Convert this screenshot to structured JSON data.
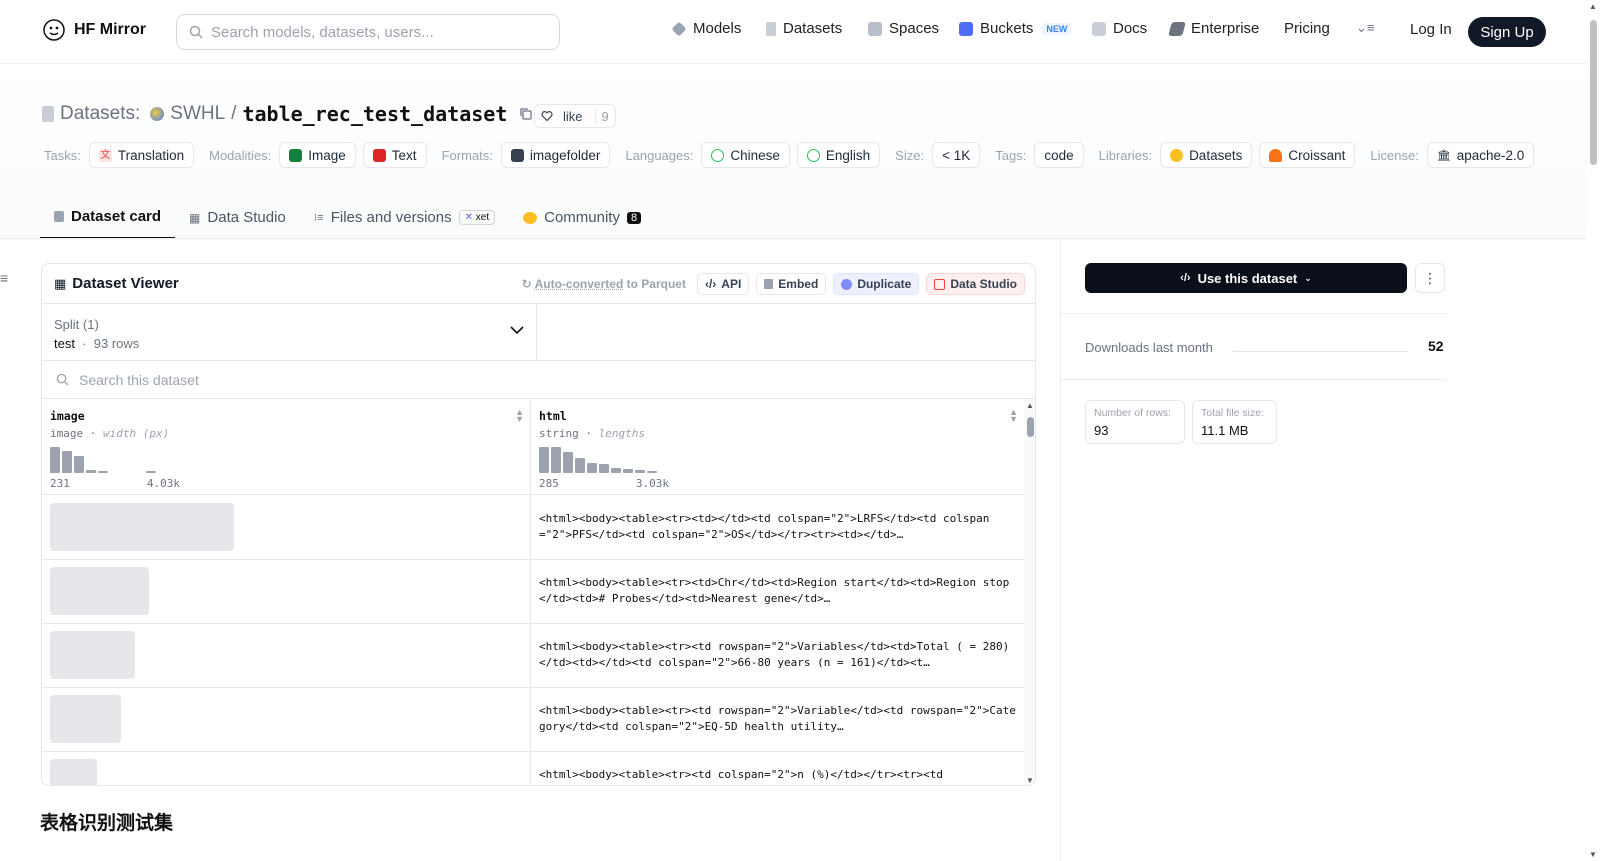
{
  "brand": {
    "name": "HF Mirror"
  },
  "search": {
    "placeholder": "Search models, datasets, users..."
  },
  "nav": {
    "models": "Models",
    "datasets": "Datasets",
    "spaces": "Spaces",
    "buckets": "Buckets",
    "new_badge": "NEW",
    "docs": "Docs",
    "enterprise": "Enterprise",
    "pricing": "Pricing",
    "login": "Log In",
    "signup": "Sign Up"
  },
  "repo": {
    "type_label": "Datasets:",
    "owner": "SWHL",
    "name": "table_rec_test_dataset",
    "like_label": "like",
    "like_count": "9"
  },
  "tags": {
    "tasks_label": "Tasks:",
    "task": "Translation",
    "modalities_label": "Modalities:",
    "modality_image": "Image",
    "modality_text": "Text",
    "formats_label": "Formats:",
    "format": "imagefolder",
    "languages_label": "Languages:",
    "lang_zh": "Chinese",
    "lang_en": "English",
    "size_label": "Size:",
    "size": "< 1K",
    "tags_label": "Tags:",
    "tag": "code",
    "libraries_label": "Libraries:",
    "lib_datasets": "Datasets",
    "lib_croissant": "Croissant",
    "license_label": "License:",
    "license": "apache-2.0"
  },
  "tabs": {
    "card": "Dataset card",
    "studio": "Data Studio",
    "files": "Files and versions",
    "xet": "xet",
    "community": "Community",
    "community_count": "8"
  },
  "viewer": {
    "title": "Dataset Viewer",
    "auto_prefix": "Auto-converted",
    "auto_suffix": " to Parquet",
    "api": "API",
    "embed": "Embed",
    "duplicate": "Duplicate",
    "studio": "Data Studio",
    "split_label": "Split (1)",
    "split_name": "test",
    "split_rows": "93 rows",
    "search_placeholder": "Search this dataset",
    "columns": [
      {
        "name": "image",
        "type": "image",
        "stat": "width (px)",
        "min": "231",
        "max": "4.03k",
        "hist": [
          1.0,
          0.86,
          0.64,
          0.1,
          0.08,
          0,
          0,
          0,
          0.05
        ]
      },
      {
        "name": "html",
        "type": "string",
        "stat": "lengths",
        "min": "285",
        "max": "3.03k",
        "hist": [
          1.0,
          1.0,
          0.82,
          0.56,
          0.38,
          0.36,
          0.18,
          0.15,
          0.1,
          0.05
        ]
      }
    ],
    "rows": [
      {
        "thumb_fraction": 0.39,
        "html": "<html><body><table><tr><td></td><td colspan=\"2\">LRFS</td><td colspan=\"2\">PFS</td><td colspan=\"2\">OS</td></tr><tr><td></td>…"
      },
      {
        "thumb_fraction": 0.21,
        "html": "<html><body><table><tr><td>Chr</td><td>Region start</td><td>Region stop</td><td># Probes</td><td>Nearest gene</td>…"
      },
      {
        "thumb_fraction": 0.18,
        "html": "<html><body><table><tr><td rowspan=\"2\">Variables</td><td>Total ( = 280)</td><td></td><td colspan=\"2\">66-80 years (n = 161)</td><t…"
      },
      {
        "thumb_fraction": 0.15,
        "html": "<html><body><table><tr><td rowspan=\"2\">Variable</td><td rowspan=\"2\">Category</td><td colspan=\"2\">EQ-5D health utility…"
      },
      {
        "thumb_fraction": 0.1,
        "html": "<html><body><table><tr><td colspan=\"2\">n (%)</td></tr><tr><td"
      }
    ]
  },
  "card": {
    "heading": "表格识别测试集"
  },
  "sidebar": {
    "use_button": "Use this dataset",
    "downloads_label": "Downloads last month",
    "downloads_value": "52",
    "rows_label": "Number of rows:",
    "rows_value": "93",
    "size_label": "Total file size:",
    "size_value": "11.1 MB"
  }
}
